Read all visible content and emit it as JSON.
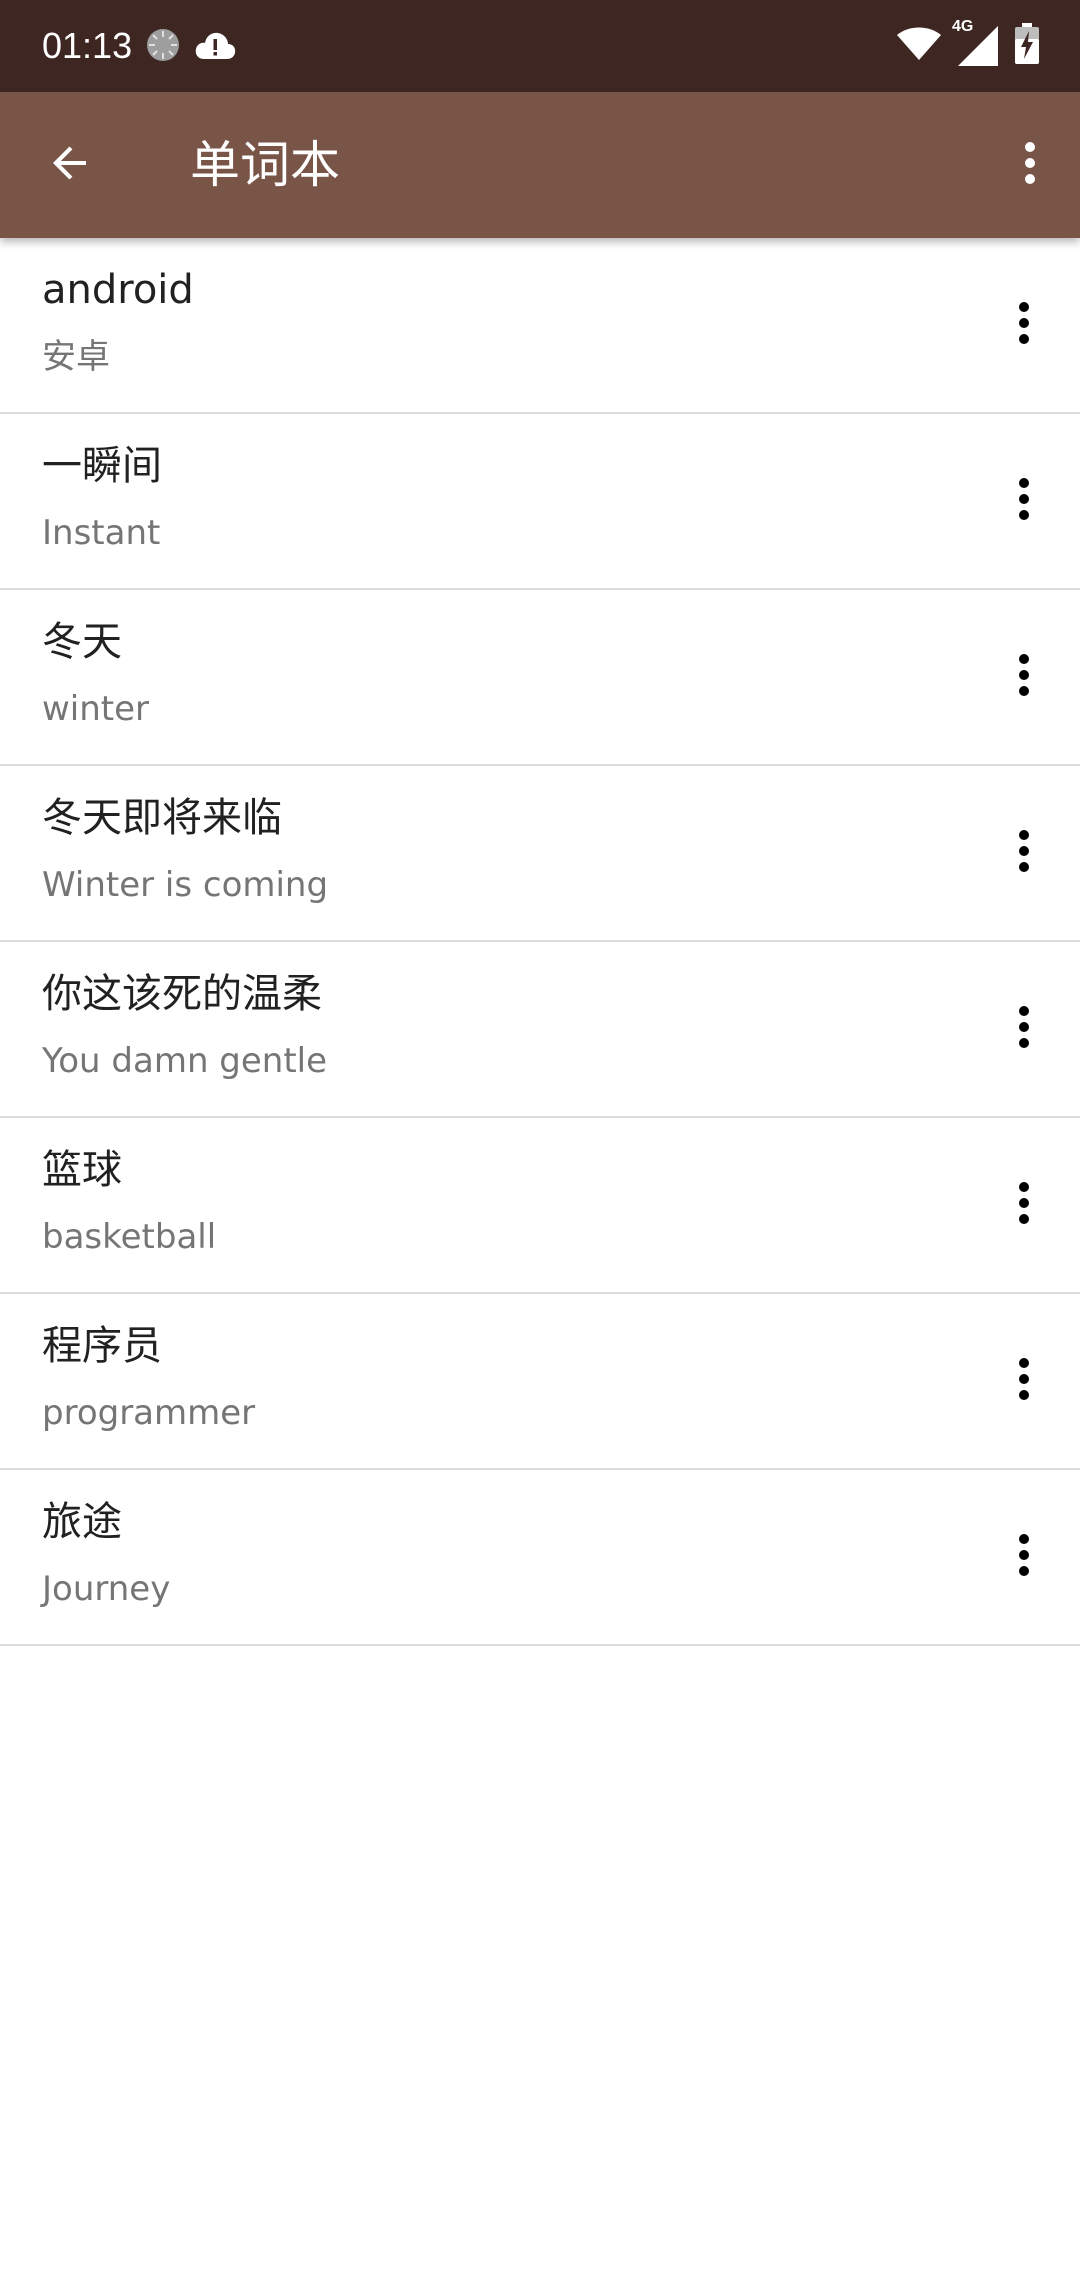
{
  "status_bar": {
    "time": "01:13",
    "network_label": "4G",
    "background_color": "#3e2723",
    "icons": [
      "loading-icon",
      "cloud-alert-icon",
      "wifi-icon",
      "signal-icon",
      "battery-icon"
    ]
  },
  "app_bar": {
    "title": "单词本",
    "background_color": "#795548",
    "back_icon": "arrow-left-icon",
    "menu_icon": "more-vert-icon"
  },
  "words": [
    {
      "word": "android",
      "translation": "安卓"
    },
    {
      "word": "一瞬间",
      "translation": "Instant"
    },
    {
      "word": "冬天",
      "translation": "winter"
    },
    {
      "word": "冬天即将来临",
      "translation": "Winter is coming"
    },
    {
      "word": "你这该死的温柔",
      "translation": "You damn gentle"
    },
    {
      "word": "篮球",
      "translation": "basketball"
    },
    {
      "word": "程序员",
      "translation": "programmer"
    },
    {
      "word": "旅途",
      "translation": "Journey"
    }
  ]
}
